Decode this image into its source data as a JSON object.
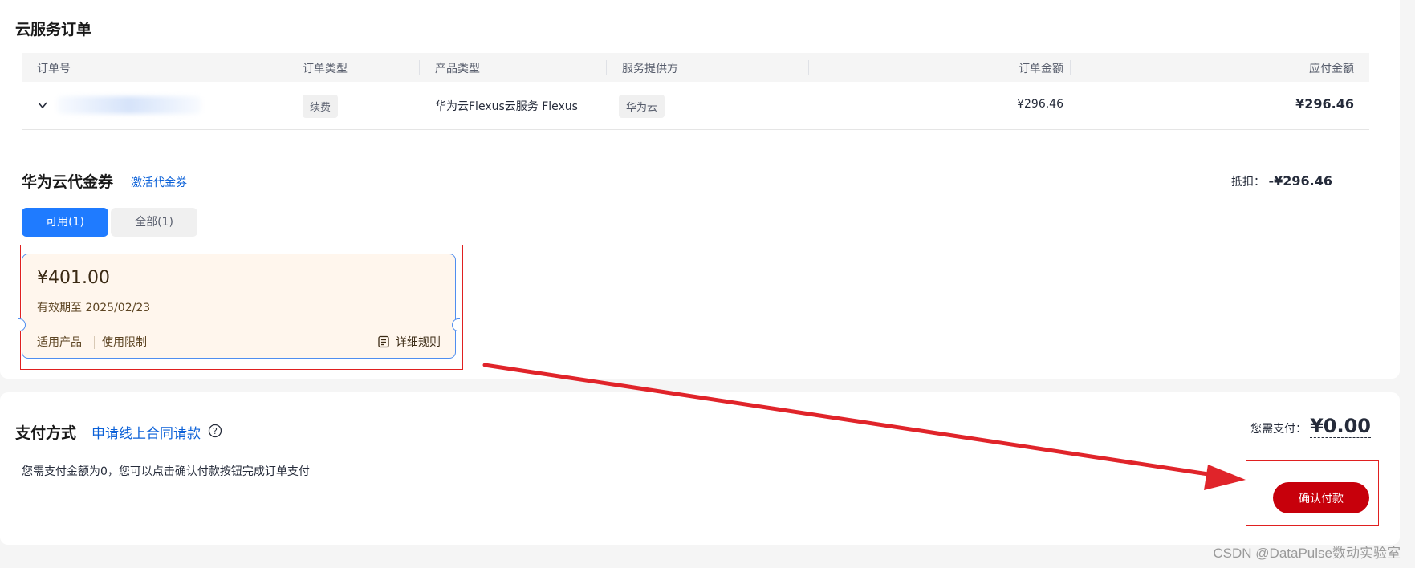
{
  "order": {
    "title": "云服务订单",
    "columns": [
      "订单号",
      "订单类型",
      "产品类型",
      "服务提供方",
      "订单金额",
      "应付金额"
    ],
    "row": {
      "order_type": "续费",
      "product": "华为云Flexus云服务 Flexus",
      "provider": "华为云",
      "amount": "¥296.46",
      "payable": "¥296.46"
    }
  },
  "voucher": {
    "title": "华为云代金券",
    "activate_link": "激活代金券",
    "deduct_label": "抵扣：",
    "deduct_value": "-¥296.46",
    "tabs": [
      {
        "label": "可用(1)",
        "active": true
      },
      {
        "label": "全部(1)",
        "active": false
      }
    ],
    "card": {
      "amount": "¥401.00",
      "validity": "有效期至 2025/02/23",
      "applicable_products": "适用产品",
      "usage_limits": "使用限制",
      "rules": "详细规则"
    }
  },
  "payment": {
    "title": "支付方式",
    "contract_link": "申请线上合同请款",
    "due_label": "您需支付：",
    "due_value": "¥0.00",
    "message": "您需支付金额为0，您可以点击确认付款按钮完成订单支付",
    "confirm_button": "确认付款"
  },
  "watermark": "CSDN @DataPulse数动实验室",
  "colors": {
    "primary_blue": "#1f7bff",
    "link_blue": "#0a60d8",
    "confirm_red": "#c7000b",
    "annotation_red": "#e02020",
    "voucher_bg": "#fff6ed"
  },
  "icons": [
    "chevron-down-icon",
    "help-circle-icon",
    "document-rules-icon"
  ]
}
